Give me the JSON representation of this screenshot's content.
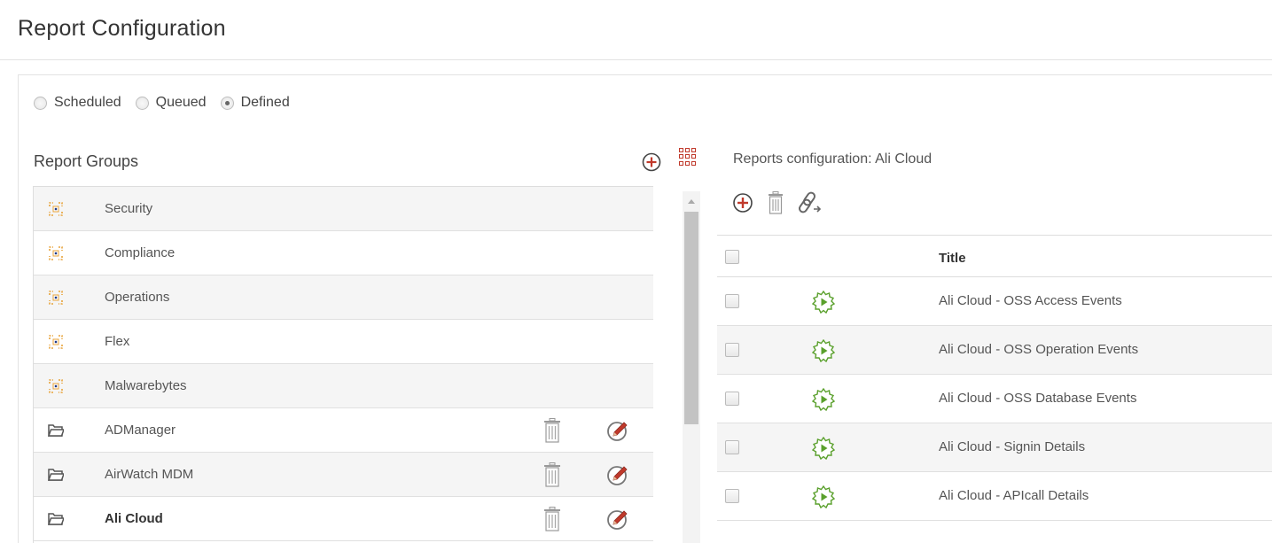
{
  "page": {
    "title": "Report Configuration"
  },
  "view_mode": {
    "options": [
      {
        "label": "Scheduled",
        "selected": false
      },
      {
        "label": "Queued",
        "selected": false
      },
      {
        "label": "Defined",
        "selected": true
      }
    ]
  },
  "report_groups": {
    "title": "Report Groups",
    "add_icon": "add-circle-icon",
    "view_icon": "grid-view-icon",
    "items": [
      {
        "label": "Security",
        "icon": "builtin-group-icon",
        "editable": false,
        "selected": false
      },
      {
        "label": "Compliance",
        "icon": "builtin-group-icon",
        "editable": false,
        "selected": false
      },
      {
        "label": "Operations",
        "icon": "builtin-group-icon",
        "editable": false,
        "selected": false
      },
      {
        "label": "Flex",
        "icon": "builtin-group-icon",
        "editable": false,
        "selected": false
      },
      {
        "label": "Malwarebytes",
        "icon": "builtin-group-icon",
        "editable": false,
        "selected": false
      },
      {
        "label": "ADManager",
        "icon": "folder-icon",
        "editable": true,
        "selected": false
      },
      {
        "label": "AirWatch MDM",
        "icon": "folder-icon",
        "editable": true,
        "selected": false
      },
      {
        "label": "Ali Cloud",
        "icon": "folder-icon",
        "editable": true,
        "selected": true
      }
    ]
  },
  "reports_config": {
    "title": "Reports configuration: Ali Cloud",
    "tools": [
      "add-circle-icon",
      "trash-icon",
      "link-icon"
    ],
    "column_title": "Title",
    "rows": [
      {
        "title": "Ali Cloud - OSS Access Events"
      },
      {
        "title": "Ali Cloud - OSS Operation Events"
      },
      {
        "title": "Ali Cloud - OSS Database Events"
      },
      {
        "title": "Ali Cloud - Signin Details"
      },
      {
        "title": "Ali Cloud - APIcall Details"
      }
    ]
  },
  "colors": {
    "accent_red": "#c0392b",
    "run_green": "#5aa02c",
    "builtin_orange": "#e8a33a",
    "row_shade": "#f5f5f5"
  }
}
